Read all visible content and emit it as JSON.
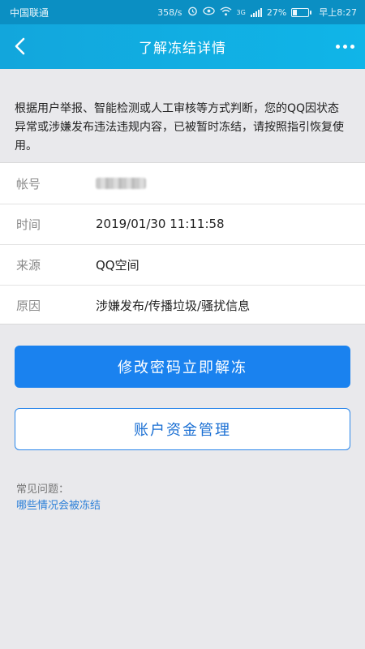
{
  "status_bar": {
    "carrier": "中国联通",
    "speed": "358/s",
    "network": "3G",
    "battery": "27%",
    "battery_level": 0.27,
    "time": "早上8:27"
  },
  "nav": {
    "title": "了解冻结详情",
    "back_icon": "chevron-left-icon",
    "more_icon": "more-dots-icon"
  },
  "notice": {
    "text": "根据用户举报、智能检测或人工审核等方式判断，您的QQ因状态异常或涉嫌发布违法违规内容，已被暂时冻结，请按照指引恢复使用。"
  },
  "details": [
    {
      "label": "帐号",
      "value": ""
    },
    {
      "label": "时间",
      "value": "2019/01/30 11:11:58"
    },
    {
      "label": "来源",
      "value": "QQ空间"
    },
    {
      "label": "原因",
      "value": "涉嫌发布/传播垃圾/骚扰信息"
    }
  ],
  "actions": {
    "primary_label": "修改密码立即解冻",
    "secondary_label": "账户资金管理"
  },
  "faq": {
    "title": "常见问题：",
    "link": "哪些情况会被冻结"
  },
  "colors": {
    "header": "#12a6dc",
    "primary_button": "#1a82ef",
    "link": "#2b7fd8"
  }
}
